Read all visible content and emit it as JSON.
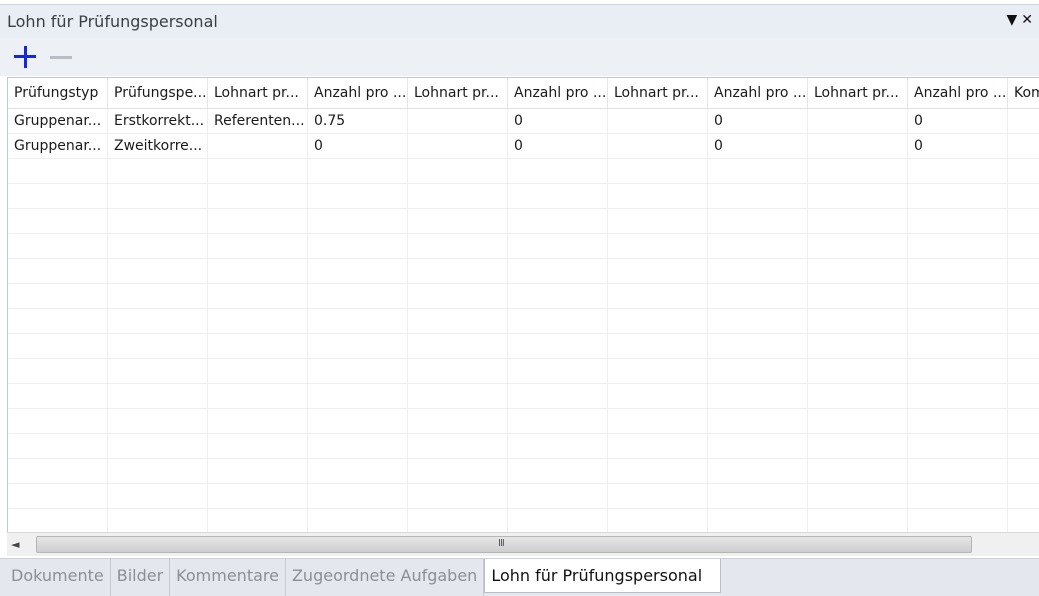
{
  "window": {
    "title": "Lohn für Prüfungspersonal"
  },
  "toolbar": {
    "add_icon": "plus-icon",
    "remove_icon": "minus-icon"
  },
  "grid": {
    "columns": [
      "Prüfungstyp",
      "Prüfungspe...",
      "Lohnart pr...",
      "Anzahl pro ...",
      "Lohnart pr...",
      "Anzahl pro ...",
      "Lohnart pr...",
      "Anzahl pro ...",
      "Lohnart pr...",
      "Anzahl pro ...",
      "Kom"
    ],
    "rows": [
      [
        "Gruppenar...",
        "Erstkorrekt...",
        "Referenten...",
        "0.75",
        "",
        "0",
        "",
        "0",
        "",
        "0",
        ""
      ],
      [
        "Gruppenar...",
        "Zweitkorre...",
        "",
        "0",
        "",
        "0",
        "",
        "0",
        "",
        "0",
        ""
      ]
    ],
    "empty_rows": 15
  },
  "scrollbar": {
    "left_arrow": "◄",
    "grip": "III"
  },
  "tabs": [
    {
      "label": "Dokumente",
      "active": false
    },
    {
      "label": "Bilder",
      "active": false
    },
    {
      "label": "Kommentare",
      "active": false
    },
    {
      "label": "Zugeordnete Aufgaben",
      "active": false
    },
    {
      "label": "Lohn für Prüfungspersonal",
      "active": true
    }
  ],
  "colors": {
    "accent": "#1428d8",
    "disabled": "#b9bec6"
  }
}
